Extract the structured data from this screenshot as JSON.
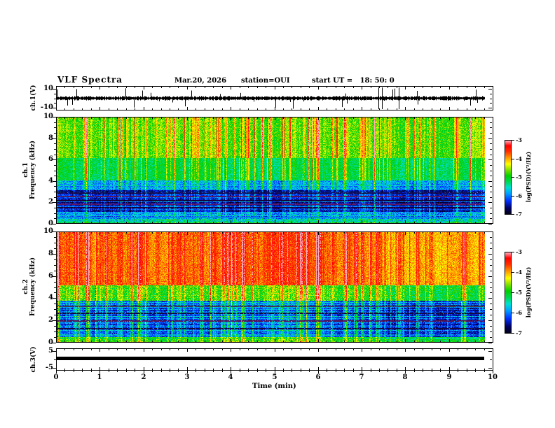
{
  "header": {
    "title": "VLF Spectra",
    "date": "Mar.20, 2026",
    "station": "station=OUI",
    "start_ut": "start UT =   18: 50: 0"
  },
  "axes": {
    "x": {
      "label": "Time (min)",
      "lim": [
        0,
        10
      ],
      "tick_labels": [
        "0",
        "1",
        "2",
        "3",
        "4",
        "5",
        "6",
        "7",
        "8",
        "9",
        "10"
      ],
      "minor_step_min": 0.2,
      "data_end_min": 9.8
    }
  },
  "panels": [
    {
      "name": "ch1-waveform",
      "ylabel": "ch.1(V)",
      "yticks": [
        {
          "v": 10,
          "label": "10"
        },
        {
          "v": -10,
          "label": "-10"
        }
      ],
      "yminor": [
        5,
        0,
        -5
      ],
      "ylim": [
        -13,
        13
      ]
    },
    {
      "name": "ch1-spectrogram",
      "ylabel_line1": "ch.1",
      "ylabel_line2": "Frequency (kHz)",
      "yticks": [
        {
          "v": 10,
          "label": "10"
        },
        {
          "v": 8,
          "label": "8"
        },
        {
          "v": 6,
          "label": "6"
        },
        {
          "v": 4,
          "label": "4"
        },
        {
          "v": 2,
          "label": "2"
        },
        {
          "v": 0,
          "label": "0"
        }
      ],
      "yminor_step": 0.5,
      "ylim": [
        0,
        10
      ]
    },
    {
      "name": "ch2-spectrogram",
      "ylabel_line1": "ch.2",
      "ylabel_line2": "Frequency (kHz)",
      "yticks": [
        {
          "v": 10,
          "label": "10"
        },
        {
          "v": 8,
          "label": "8"
        },
        {
          "v": 6,
          "label": "6"
        },
        {
          "v": 4,
          "label": "4"
        },
        {
          "v": 2,
          "label": "2"
        },
        {
          "v": 0,
          "label": "0"
        }
      ],
      "yminor_step": 0.5,
      "ylim": [
        0,
        10
      ]
    },
    {
      "name": "ch3-waveform",
      "ylabel": "ch.3(V)",
      "yticks": [
        {
          "v": 5,
          "label": "5"
        },
        {
          "v": -5,
          "label": "-5"
        }
      ],
      "yminor": [
        0
      ],
      "ylim": [
        -6.5,
        6.5
      ]
    }
  ],
  "colorbars": [
    {
      "label": "log(PSD)(V²/Hz)",
      "tick_labels": [
        "-3",
        "-4",
        "-5",
        "-6",
        "-7"
      ],
      "range": [
        -3,
        -7
      ]
    },
    {
      "label": "log(PSD)(V²/Hz)",
      "tick_labels": [
        "-3",
        "-4",
        "-5",
        "-6",
        "-7"
      ],
      "range": [
        -3,
        -7
      ]
    }
  ],
  "chart_data": [
    {
      "type": "line",
      "title": "ch.1(V) time series",
      "xlabel": "Time (min)",
      "xlim": [
        0,
        9.8
      ],
      "ylabel": "ch.1(V)",
      "ylim": [
        -10,
        10
      ],
      "yticks": [
        10,
        -10
      ],
      "summary": "broadband noise waveform centered on 0 V, typical amplitude about ±2 V with frequent impulsive spikes reaching about ±8 V across the full 0–9.8 min record"
    },
    {
      "type": "heatmap",
      "title": "ch.1 VLF spectrogram",
      "xlabel": "Time (min)",
      "xlim": [
        0,
        9.8
      ],
      "ylabel": "Frequency (kHz)",
      "ylim": [
        0,
        10
      ],
      "yticks": [
        0,
        2,
        4,
        6,
        8,
        10
      ],
      "colorbar_label": "log(PSD)(V²/Hz)",
      "colorbar_range": [
        -7,
        -3
      ],
      "bands": [
        {
          "f_khz": [
            6.2,
            10
          ],
          "psd_log10": -4.0,
          "appearance": "yellow-green background with dense vertical red/orange sferic streaks"
        },
        {
          "f_khz": [
            4.1,
            6.2
          ],
          "psd_log10": -5.0,
          "appearance": "green, vertical streak modulation"
        },
        {
          "f_khz": [
            1.1,
            4.1
          ],
          "psd_log10": -6.3,
          "appearance": "dark blue/navy with horizontal banding and dark power-line harmonic rows near 1.5-2.9 kHz"
        },
        {
          "f_khz": [
            0,
            1.1
          ],
          "psd_log10": -5.6,
          "appearance": "cyan/blue horizontal stripes"
        }
      ]
    },
    {
      "type": "heatmap",
      "title": "ch.2 VLF spectrogram",
      "xlabel": "Time (min)",
      "xlim": [
        0,
        9.8
      ],
      "ylabel": "Frequency (kHz)",
      "ylim": [
        0,
        10
      ],
      "yticks": [
        0,
        2,
        4,
        6,
        8,
        10
      ],
      "colorbar_label": "log(PSD)(V²/Hz)",
      "colorbar_range": [
        -7,
        -3
      ],
      "bands": [
        {
          "f_khz": [
            5.2,
            10
          ],
          "psd_log10": -3.8,
          "appearance": "red/orange dominated with yellow vertical streaks"
        },
        {
          "f_khz": [
            3.8,
            5.2
          ],
          "psd_log10": -5.0,
          "appearance": "spiky green/yellow transition boundary"
        },
        {
          "f_khz": [
            0.5,
            3.8
          ],
          "psd_log10": -6.2,
          "appearance": "blue/navy with cyan-green vertical bursts and horizontal banding"
        },
        {
          "f_khz": [
            0,
            0.5
          ],
          "psd_log10": -5.2,
          "appearance": "green/cyan band"
        }
      ]
    },
    {
      "type": "line",
      "title": "ch.3(V) time series",
      "xlabel": "Time (min)",
      "xlim": [
        0,
        9.8
      ],
      "ylabel": "ch.3(V)",
      "ylim": [
        -5,
        5
      ],
      "yticks": [
        5,
        -5
      ],
      "values": "constant 0 V (flat thick line) from 0 to 9.8 min"
    }
  ],
  "palette_stops": [
    [
      0.0,
      "#000018"
    ],
    [
      0.08,
      "#000060"
    ],
    [
      0.18,
      "#0030ff"
    ],
    [
      0.28,
      "#00a0ff"
    ],
    [
      0.36,
      "#00e0d0"
    ],
    [
      0.44,
      "#00d850"
    ],
    [
      0.52,
      "#00d000"
    ],
    [
      0.6,
      "#80e000"
    ],
    [
      0.68,
      "#ffff00"
    ],
    [
      0.76,
      "#ffa000"
    ],
    [
      0.85,
      "#ff3000"
    ],
    [
      0.93,
      "#ff0000"
    ],
    [
      1.0,
      "#ffb0c0"
    ]
  ],
  "spectrogram_models": {
    "ch1": {
      "seed": 1337,
      "bands": [
        {
          "f": [
            0,
            0.35
          ],
          "base": 0.42,
          "stripe": 0.28,
          "streak": 0.12,
          "noise": 0.22
        },
        {
          "f": [
            0.35,
            1.1
          ],
          "base": 0.34,
          "stripe": 0.3,
          "streak": 0.15,
          "noise": 0.2
        },
        {
          "f": [
            1.1,
            3.2
          ],
          "base": 0.17,
          "stripe": 0.26,
          "streak": 0.2,
          "noise": 0.16
        },
        {
          "f": [
            3.2,
            4.1
          ],
          "base": 0.3,
          "stripe": 0.12,
          "streak": 0.3,
          "noise": 0.18
        },
        {
          "f": [
            4.1,
            6.2
          ],
          "base": 0.47,
          "stripe": 0.04,
          "streak": 0.35,
          "noise": 0.14
        },
        {
          "f": [
            6.2,
            10
          ],
          "base": 0.58,
          "stripe": 0.03,
          "streak": 0.42,
          "noise": 0.16
        }
      ],
      "dark_rows": [
        {
          "f": 1.5,
          "color": [
            24,
            4,
            60
          ]
        },
        {
          "f": 1.85,
          "color": [
            96,
            24,
            96
          ]
        },
        {
          "f": 2.2,
          "color": [
            24,
            4,
            60
          ]
        },
        {
          "f": 2.55,
          "color": [
            90,
            20,
            80
          ]
        },
        {
          "f": 2.9,
          "color": [
            24,
            4,
            60
          ]
        },
        {
          "f": 0.6,
          "color": [
            0,
            140,
            220
          ]
        }
      ]
    },
    "ch2": {
      "seed": 7642,
      "bands": [
        {
          "f": [
            0,
            0.5
          ],
          "base": 0.46,
          "stripe": 0.2,
          "streak": 0.18,
          "noise": 0.18
        },
        {
          "f": [
            0.5,
            3.8
          ],
          "base": 0.19,
          "stripe": 0.28,
          "streak": 0.32,
          "noise": 0.18
        },
        {
          "f": [
            3.8,
            5.2
          ],
          "base": 0.5,
          "stripe": 0.08,
          "streak": 0.35,
          "noise": 0.2
        },
        {
          "f": [
            5.2,
            10
          ],
          "base": 0.77,
          "stripe": 0.02,
          "streak": 0.22,
          "noise": 0.14
        }
      ],
      "dark_rows": [
        {
          "f": 1.3,
          "color": [
            20,
            8,
            60
          ]
        },
        {
          "f": 2.0,
          "color": [
            90,
            20,
            80
          ]
        },
        {
          "f": 2.7,
          "color": [
            20,
            8,
            60
          ]
        },
        {
          "f": 3.3,
          "color": [
            60,
            60,
            70
          ]
        }
      ]
    }
  },
  "waveform_model": {
    "seed": 99,
    "band": 2.2,
    "spike_prob": 0.05,
    "spike_max": 13,
    "tall_prob": 0.008
  }
}
